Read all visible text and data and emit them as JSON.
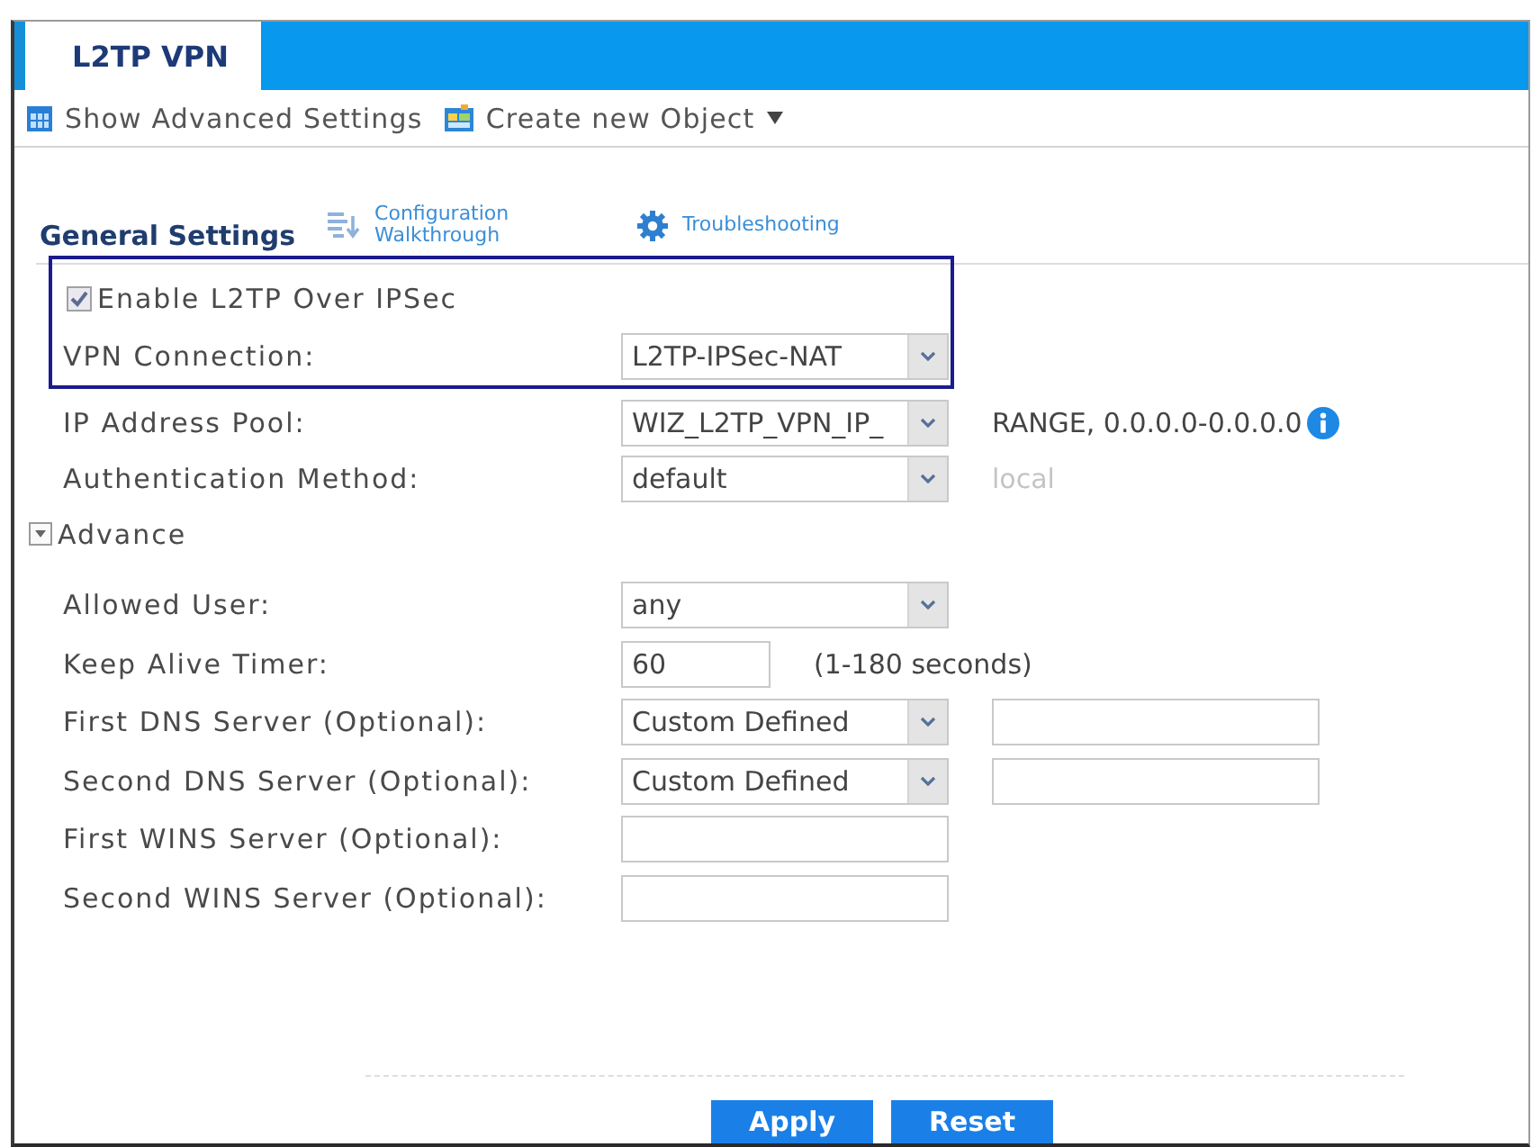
{
  "tabs": [
    {
      "label": "L2TP VPN",
      "selected": true
    }
  ],
  "toolbar": [
    {
      "kind": "advanced",
      "label": "Show Advanced Settings",
      "menu": false
    },
    {
      "kind": "create",
      "label": "Create new Object",
      "menu": true
    }
  ],
  "section": {
    "title": "General Settings",
    "links": [
      {
        "kind": "walkthrough",
        "label": "Configuration Walkthrough"
      },
      {
        "kind": "troubleshooting",
        "label": "Troubleshooting"
      }
    ]
  },
  "fields": [
    {
      "kind": "checkbox",
      "label": "Enable L2TP Over IPSec",
      "checked": true,
      "highlighted": true
    },
    {
      "kind": "select",
      "label": "VPN Connection:",
      "value": "L2TP-IPSec-NAT",
      "highlighted": true
    },
    {
      "kind": "select",
      "label": "IP Address Pool:",
      "value": "WIZ_L2TP_VPN_IP_",
      "highlighted": false,
      "note": "RANGE, 0.0.0.0-0.0.0.0",
      "note_disabled": false,
      "info": true
    },
    {
      "kind": "select",
      "label": "Authentication Method:",
      "value": "default",
      "highlighted": false,
      "note": "local",
      "note_disabled": true,
      "info": false
    }
  ],
  "advance": {
    "label": "Advance",
    "expanded": true,
    "fields": [
      {
        "kind": "select",
        "label": "Allowed User:",
        "value": "any"
      },
      {
        "kind": "short_input",
        "label": "Keep Alive Timer:",
        "value": "60",
        "note": "(1-180 seconds)"
      },
      {
        "kind": "select_input",
        "label": "First DNS Server (Optional):",
        "value": "Custom Defined"
      },
      {
        "kind": "select_input",
        "label": "Second DNS Server (Optional):",
        "value": "Custom Defined"
      },
      {
        "kind": "input",
        "label": "First WINS Server (Optional):"
      },
      {
        "kind": "input",
        "label": "Second WINS Server (Optional):"
      }
    ]
  },
  "buttons": [
    {
      "label": "Apply"
    },
    {
      "label": "Reset"
    }
  ]
}
